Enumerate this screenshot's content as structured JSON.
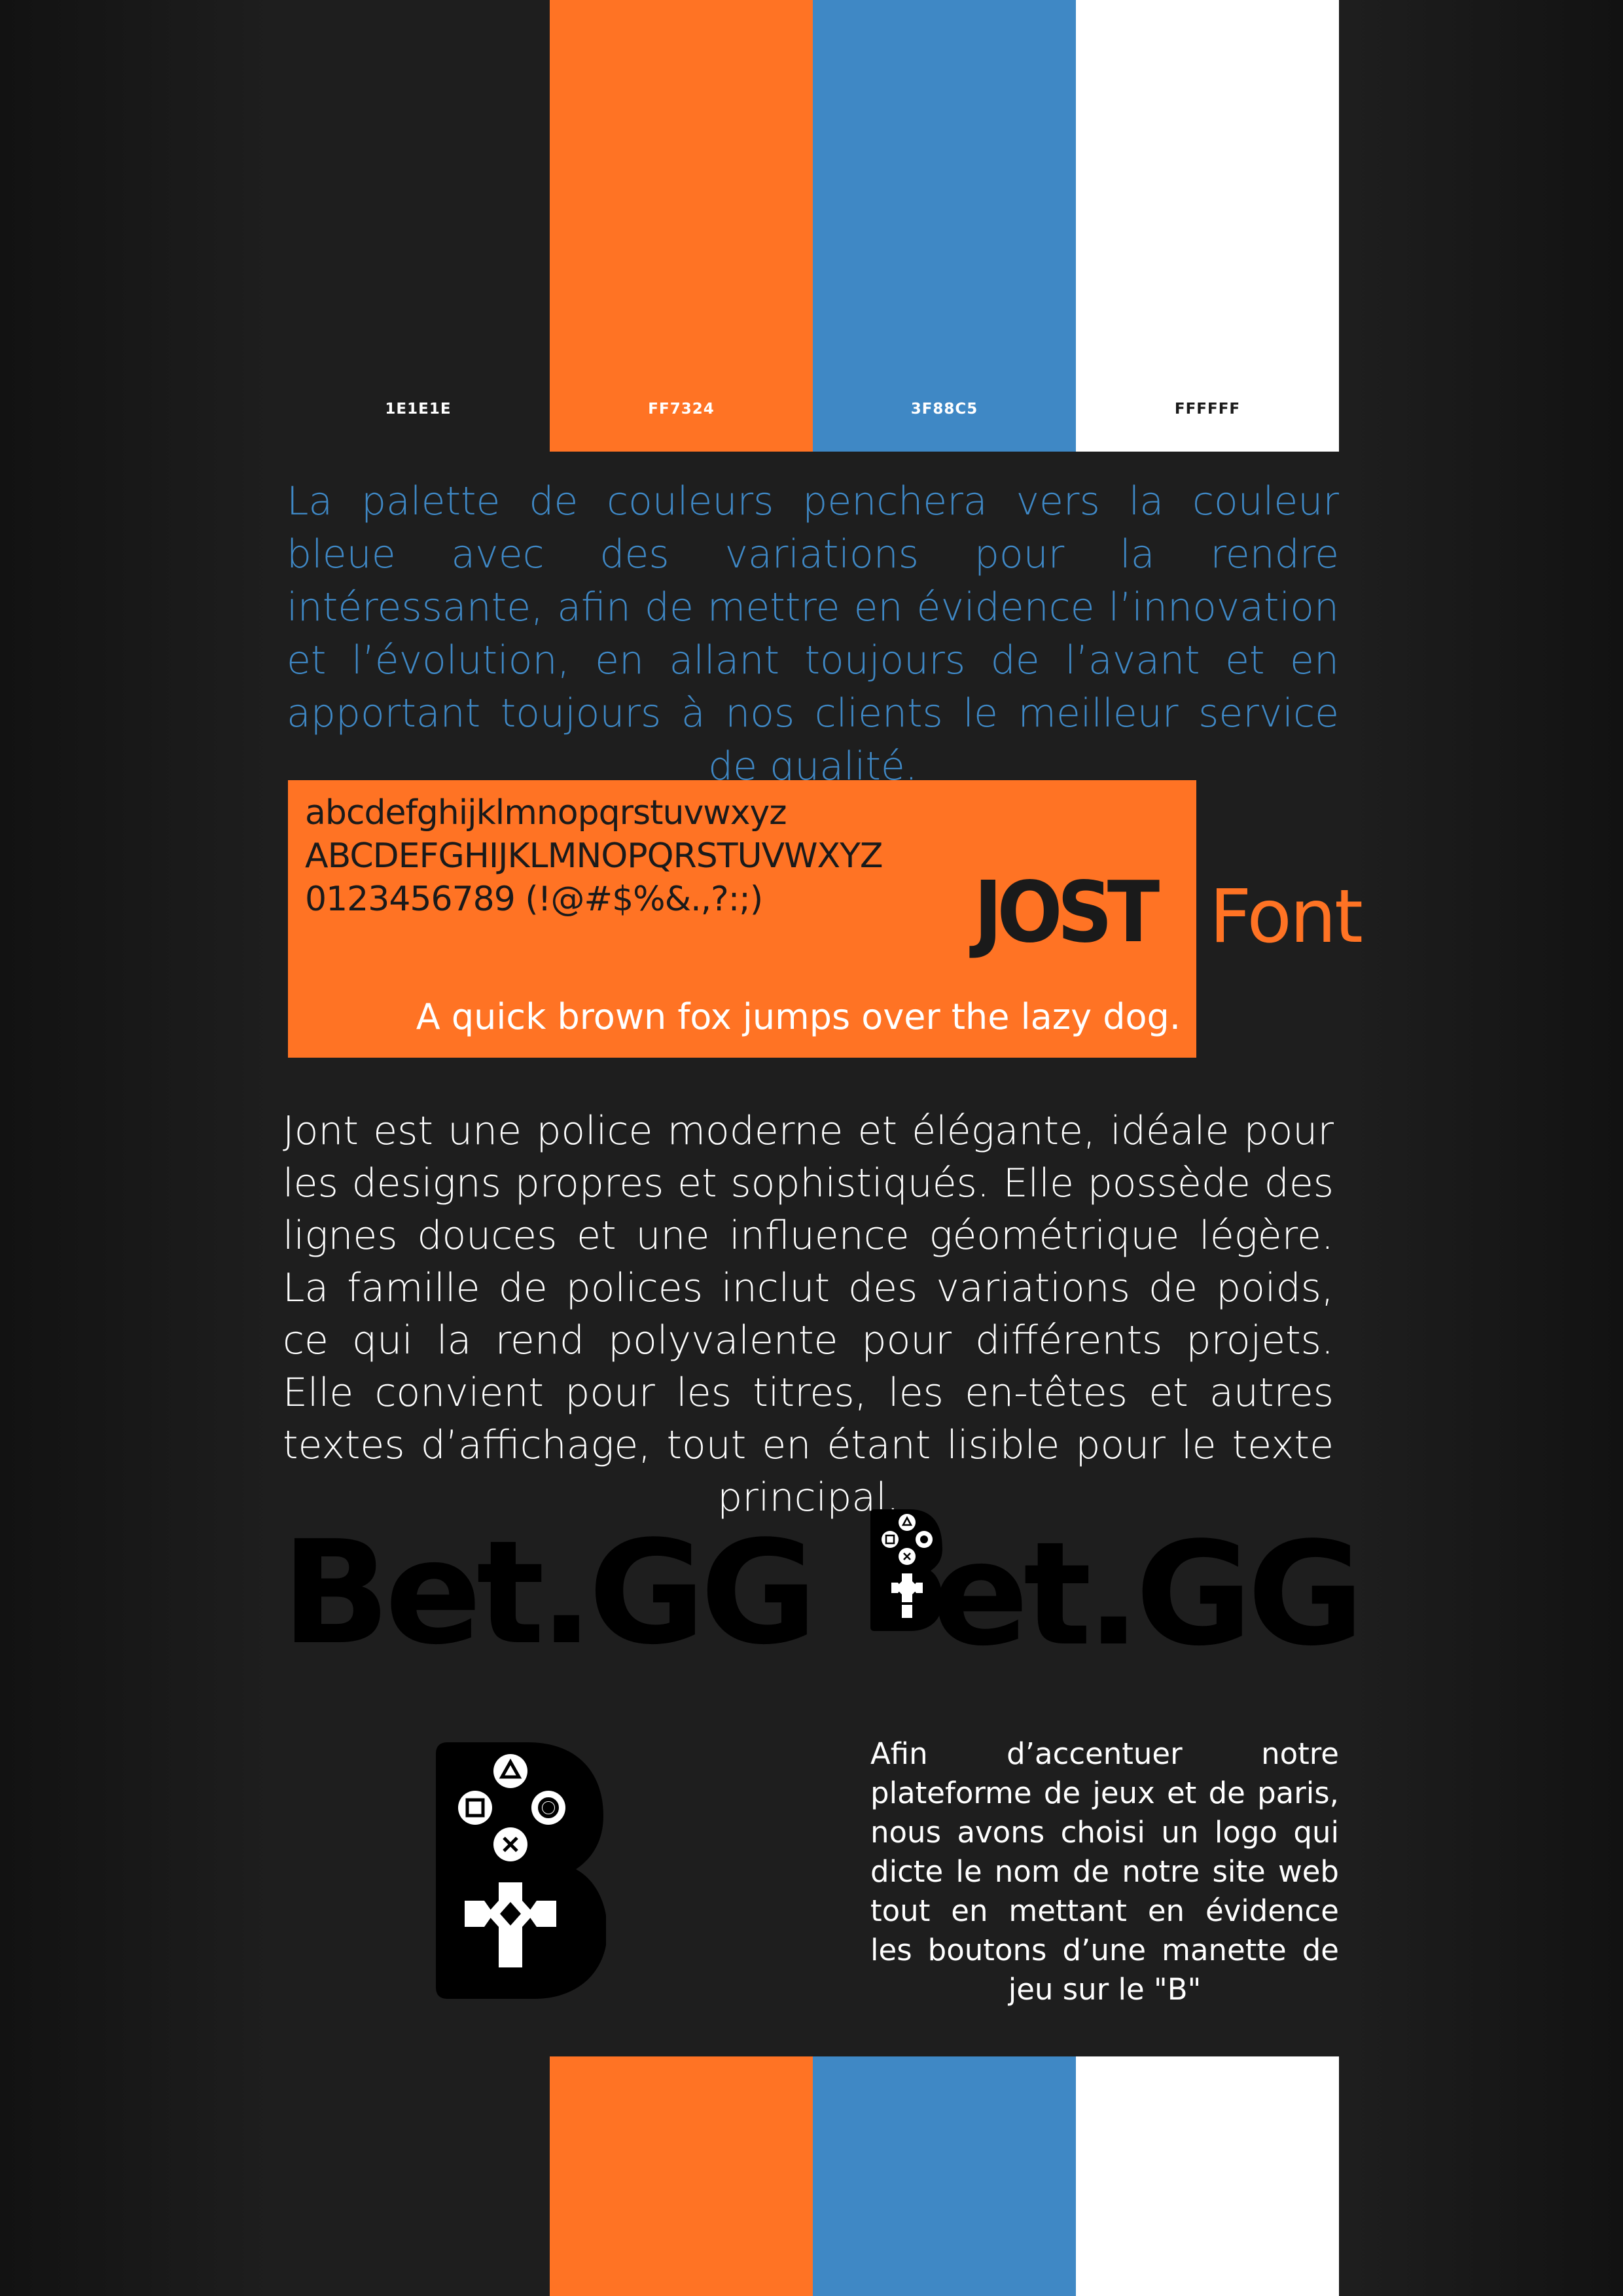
{
  "palette": {
    "swatches": [
      {
        "hex": "1E1E1E",
        "color": "#1e1e1e",
        "label_color": "#ffffff"
      },
      {
        "hex": "FF7324",
        "color": "#ff7324",
        "label_color": "#ffffff"
      },
      {
        "hex": "3F88C5",
        "color": "#3f88c5",
        "label_color": "#ffffff"
      },
      {
        "hex": "FFFFFF",
        "color": "#ffffff",
        "label_color": "#1a1a1a"
      }
    ]
  },
  "color_description": "La palette de couleurs penchera vers la couleur bleue avec des variations pour la rendre intéressante, afin de mettre en évidence l’innovation et l’évolution, en allant toujours de l’avant et en apportant toujours à nos clients le meilleur service de qualité.",
  "font_specimen": {
    "lowercase": "abcdefghijklmnopqrstuvwxyz",
    "uppercase": "ABCDEFGHIJKLMNOPQRSTUVWXYZ",
    "digits": "0123456789 (!@#$%&.,?:;)",
    "pangram": "A quick brown fox jumps over the lazy dog.",
    "font_name": "JOST",
    "font_word": "Font"
  },
  "font_description": "Jont est une police moderne et élégante, idéale pour les designs propres et sophistiqués. Elle possède des lignes douces et une influence géométrique légère. La famille de polices inclut des variations de poids, ce qui la rend polyvalente pour différents projets. Elle convient pour les titres, les en-têtes et autres textes d’affichage, tout en étant lisible pour le texte principal.",
  "logo": {
    "wordmark_plain": "Bet.GG",
    "wordmark_rest": "et.GG",
    "icon_name": "controller-b-icon"
  },
  "logo_description": "Afin d’accentuer notre plateforme de jeux et de paris, nous avons choisi un logo qui dicte le nom de notre site web tout en mettant en évidence les boutons d’une manette de jeu sur le \"B\""
}
